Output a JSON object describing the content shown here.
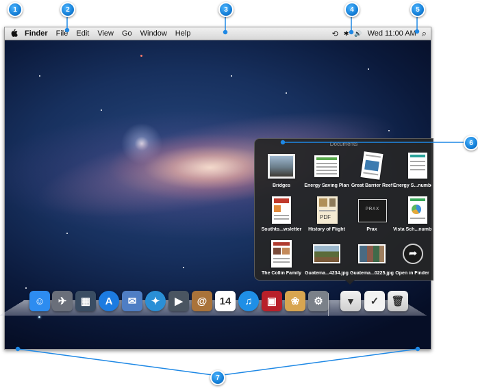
{
  "menubar": {
    "apple_icon": "apple-icon",
    "app_name": "Finder",
    "menus": [
      "File",
      "Edit",
      "View",
      "Go",
      "Window",
      "Help"
    ],
    "status_icons": [
      "time-machine-icon",
      "bluetooth-icon",
      "volume-icon"
    ],
    "time_machine_glyph": "⟲",
    "bluetooth_glyph": "✱",
    "volume_glyph": "🔊",
    "clock": "Wed 11:00 AM",
    "spotlight_glyph": "⌕"
  },
  "stack": {
    "title": "Documents",
    "items": [
      {
        "label": "Bridges",
        "icon": "photo-document-icon"
      },
      {
        "label": "Energy Saving Plan",
        "icon": "spreadsheet-document-icon"
      },
      {
        "label": "Great Barrier Reef",
        "icon": "page-document-icon"
      },
      {
        "label": "Energy S...numbers",
        "icon": "spreadsheet-document-icon"
      },
      {
        "label": "Southto...wsletter",
        "icon": "page-document-icon"
      },
      {
        "label": "History of Flight",
        "icon": "pdf-document-icon",
        "badge": "PDF"
      },
      {
        "label": "Prax",
        "icon": "presentation-document-icon",
        "badge": "PRAX"
      },
      {
        "label": "Vista Sch...numbers",
        "icon": "spreadsheet-document-icon"
      },
      {
        "label": "The Collin Family",
        "icon": "page-document-icon"
      },
      {
        "label": "Guatema...4234.jpg",
        "icon": "photo-icon"
      },
      {
        "label": "Guatema...0225.jpg",
        "icon": "photo-icon"
      },
      {
        "label": "Open in Finder",
        "icon": "open-in-finder-icon"
      }
    ]
  },
  "dock": {
    "apps": [
      {
        "name": "finder-dock-icon",
        "glyph": "☺",
        "color": "#2d8cf0"
      },
      {
        "name": "launchpad-dock-icon",
        "glyph": "✈",
        "color": "#6a6f7a"
      },
      {
        "name": "mission-control-dock-icon",
        "glyph": "▦",
        "color": "#3a4d63"
      },
      {
        "name": "app-store-dock-icon",
        "glyph": "A",
        "color": "#1c7be0"
      },
      {
        "name": "mail-dock-icon",
        "glyph": "✉",
        "color": "#4f7ec4"
      },
      {
        "name": "safari-dock-icon",
        "glyph": "✦",
        "color": "#2a8fd6"
      },
      {
        "name": "facetime-dock-icon",
        "glyph": "▶",
        "color": "#4a5561"
      },
      {
        "name": "address-book-dock-icon",
        "glyph": "@",
        "color": "#a9733a"
      },
      {
        "name": "ical-dock-icon",
        "glyph": "14",
        "color": "#ffffff"
      },
      {
        "name": "itunes-dock-icon",
        "glyph": "♫",
        "color": "#1f8fe6"
      },
      {
        "name": "photo-booth-dock-icon",
        "glyph": "▣",
        "color": "#b8202a"
      },
      {
        "name": "iphoto-dock-icon",
        "glyph": "❀",
        "color": "#d8a550"
      },
      {
        "name": "system-preferences-dock-icon",
        "glyph": "⚙",
        "color": "#7b8189"
      }
    ],
    "stacks": [
      {
        "name": "documents-stack-dock-icon",
        "glyph": "▾",
        "color": "#cfcfcf"
      },
      {
        "name": "downloads-stack-dock-icon",
        "glyph": "✓",
        "color": "#f4f4f4"
      },
      {
        "name": "trash-dock-icon",
        "glyph": "🗑",
        "color": "#c9c9c9"
      }
    ]
  },
  "callouts": [
    "1",
    "2",
    "3",
    "4",
    "5",
    "6",
    "7"
  ]
}
